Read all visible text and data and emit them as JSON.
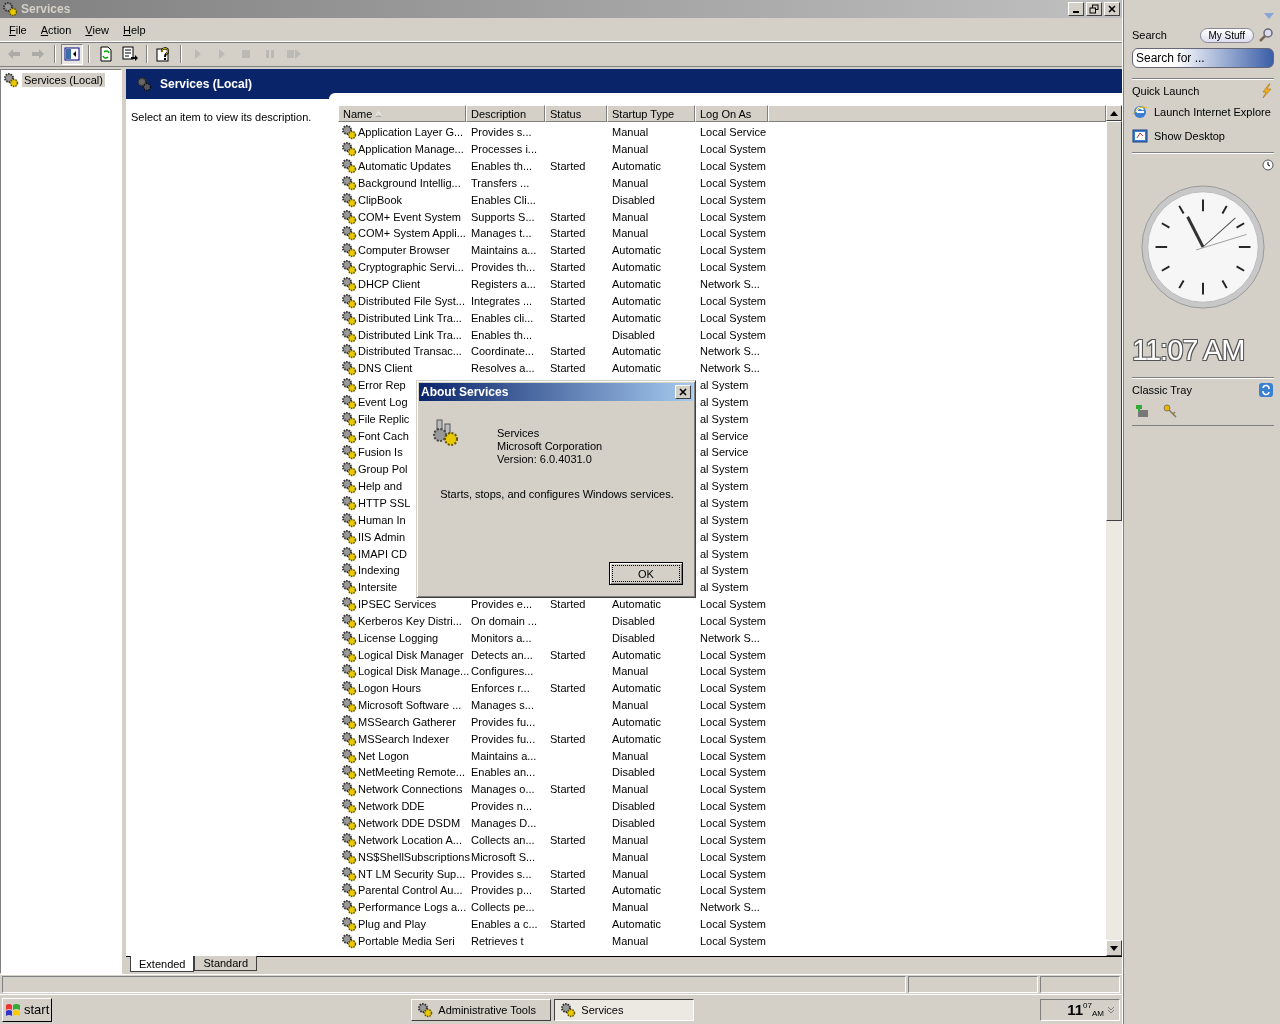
{
  "window": {
    "title": "Services"
  },
  "menu": [
    "File",
    "Action",
    "View",
    "Help"
  ],
  "toolbar": {
    "groups": [
      [
        {
          "kind": "back",
          "disabled": true,
          "pressed": false
        },
        {
          "kind": "forward",
          "disabled": true,
          "pressed": false
        }
      ],
      [
        {
          "kind": "tree",
          "disabled": false,
          "pressed": true
        }
      ],
      [
        {
          "kind": "refresh",
          "disabled": false,
          "pressed": false
        },
        {
          "kind": "export",
          "disabled": false,
          "pressed": false
        }
      ],
      [
        {
          "kind": "help",
          "disabled": false,
          "pressed": false
        }
      ],
      [
        {
          "kind": "start",
          "disabled": true,
          "pressed": false
        },
        {
          "kind": "start",
          "disabled": true,
          "pressed": false
        },
        {
          "kind": "stop",
          "disabled": true,
          "pressed": false
        },
        {
          "kind": "pause",
          "disabled": true,
          "pressed": false
        },
        {
          "kind": "restart",
          "disabled": true,
          "pressed": false
        }
      ]
    ]
  },
  "tree": {
    "items": [
      {
        "label": "Services (Local)",
        "selected": true
      }
    ]
  },
  "panel": {
    "title": "Services (Local)",
    "description": "Select an item to view its description."
  },
  "table": {
    "columns": [
      {
        "label": "Name",
        "sorted": true
      },
      {
        "label": "Description",
        "sorted": false
      },
      {
        "label": "Status",
        "sorted": false
      },
      {
        "label": "Startup Type",
        "sorted": false
      },
      {
        "label": "Log On As",
        "sorted": false
      }
    ],
    "rows": [
      {
        "name": "Application Layer G...",
        "description": "Provides s...",
        "startup_type": "Manual",
        "log_on_as": "Local Service"
      },
      {
        "name": "Application Manage...",
        "description": "Processes i...",
        "startup_type": "Manual",
        "log_on_as": "Local System"
      },
      {
        "name": "Automatic Updates",
        "description": "Enables th...",
        "status": "Started",
        "startup_type": "Automatic",
        "log_on_as": "Local System"
      },
      {
        "name": "Background Intellig...",
        "description": "Transfers ...",
        "startup_type": "Manual",
        "log_on_as": "Local System"
      },
      {
        "name": "ClipBook",
        "description": "Enables Cli...",
        "startup_type": "Disabled",
        "log_on_as": "Local System"
      },
      {
        "name": "COM+ Event System",
        "description": "Supports S...",
        "status": "Started",
        "startup_type": "Manual",
        "log_on_as": "Local System"
      },
      {
        "name": "COM+ System Appli...",
        "description": "Manages t...",
        "status": "Started",
        "startup_type": "Manual",
        "log_on_as": "Local System"
      },
      {
        "name": "Computer Browser",
        "description": "Maintains a...",
        "status": "Started",
        "startup_type": "Automatic",
        "log_on_as": "Local System"
      },
      {
        "name": "Cryptographic Servi...",
        "description": "Provides th...",
        "status": "Started",
        "startup_type": "Automatic",
        "log_on_as": "Local System"
      },
      {
        "name": "DHCP Client",
        "description": "Registers a...",
        "status": "Started",
        "startup_type": "Automatic",
        "log_on_as": "Network S..."
      },
      {
        "name": "Distributed File Syst...",
        "description": "Integrates ...",
        "status": "Started",
        "startup_type": "Automatic",
        "log_on_as": "Local System"
      },
      {
        "name": "Distributed Link Tra...",
        "description": "Enables cli...",
        "status": "Started",
        "startup_type": "Automatic",
        "log_on_as": "Local System"
      },
      {
        "name": "Distributed Link Tra...",
        "description": "Enables th...",
        "startup_type": "Disabled",
        "log_on_as": "Local System"
      },
      {
        "name": "Distributed Transac...",
        "description": "Coordinate...",
        "status": "Started",
        "startup_type": "Automatic",
        "log_on_as": "Network S..."
      },
      {
        "name": "DNS Client",
        "description": "Resolves a...",
        "status": "Started",
        "startup_type": "Automatic",
        "log_on_as": "Network S..."
      },
      {
        "name": "Error Rep",
        "log_on_as": "al System"
      },
      {
        "name": "Event Log",
        "log_on_as": "al System"
      },
      {
        "name": "File Replic",
        "log_on_as": "al System"
      },
      {
        "name": "Font Cach",
        "log_on_as": "al Service"
      },
      {
        "name": "Fusion Is",
        "log_on_as": "al Service"
      },
      {
        "name": "Group Pol",
        "log_on_as": "al System"
      },
      {
        "name": "Help and",
        "log_on_as": "al System"
      },
      {
        "name": "HTTP SSL",
        "log_on_as": "al System"
      },
      {
        "name": "Human In",
        "log_on_as": "al System"
      },
      {
        "name": "IIS Admin",
        "log_on_as": "al System"
      },
      {
        "name": "IMAPI CD",
        "log_on_as": "al System"
      },
      {
        "name": "Indexing",
        "log_on_as": "al System"
      },
      {
        "name": "Intersite",
        "log_on_as": "al System"
      },
      {
        "name": "IPSEC Services",
        "description": "Provides e...",
        "status": "Started",
        "startup_type": "Automatic",
        "log_on_as": "Local System"
      },
      {
        "name": "Kerberos Key Distri...",
        "description": "On domain ...",
        "startup_type": "Disabled",
        "log_on_as": "Local System"
      },
      {
        "name": "License Logging",
        "description": "Monitors a...",
        "startup_type": "Disabled",
        "log_on_as": "Network S..."
      },
      {
        "name": "Logical Disk Manager",
        "description": "Detects an...",
        "status": "Started",
        "startup_type": "Automatic",
        "log_on_as": "Local System"
      },
      {
        "name": "Logical Disk Manage...",
        "description": "Configures...",
        "startup_type": "Manual",
        "log_on_as": "Local System"
      },
      {
        "name": "Logon Hours",
        "description": "Enforces r...",
        "status": "Started",
        "startup_type": "Automatic",
        "log_on_as": "Local System"
      },
      {
        "name": "Microsoft Software ...",
        "description": "Manages s...",
        "startup_type": "Manual",
        "log_on_as": "Local System"
      },
      {
        "name": "MSSearch Gatherer",
        "description": "Provides fu...",
        "startup_type": "Automatic",
        "log_on_as": "Local System"
      },
      {
        "name": "MSSearch Indexer",
        "description": "Provides fu...",
        "status": "Started",
        "startup_type": "Automatic",
        "log_on_as": "Local System"
      },
      {
        "name": "Net Logon",
        "description": "Maintains a...",
        "startup_type": "Manual",
        "log_on_as": "Local System"
      },
      {
        "name": "NetMeeting Remote...",
        "description": "Enables an...",
        "startup_type": "Disabled",
        "log_on_as": "Local System"
      },
      {
        "name": "Network Connections",
        "description": "Manages o...",
        "status": "Started",
        "startup_type": "Manual",
        "log_on_as": "Local System"
      },
      {
        "name": "Network DDE",
        "description": "Provides n...",
        "startup_type": "Disabled",
        "log_on_as": "Local System"
      },
      {
        "name": "Network DDE DSDM",
        "description": "Manages D...",
        "startup_type": "Disabled",
        "log_on_as": "Local System"
      },
      {
        "name": "Network Location A...",
        "description": "Collects an...",
        "status": "Started",
        "startup_type": "Manual",
        "log_on_as": "Local System"
      },
      {
        "name": "NS$ShellSubscriptions",
        "description": "Microsoft S...",
        "startup_type": "Manual",
        "log_on_as": "Local System"
      },
      {
        "name": "NT LM Security Sup...",
        "description": "Provides s...",
        "status": "Started",
        "startup_type": "Manual",
        "log_on_as": "Local System"
      },
      {
        "name": "Parental Control Au...",
        "description": "Provides p...",
        "status": "Started",
        "startup_type": "Automatic",
        "log_on_as": "Local System"
      },
      {
        "name": "Performance Logs a...",
        "description": "Collects pe...",
        "startup_type": "Manual",
        "log_on_as": "Network S..."
      },
      {
        "name": "Plug and Play",
        "description": "Enables a c...",
        "status": "Started",
        "startup_type": "Automatic",
        "log_on_as": "Local System"
      },
      {
        "name": "Portable Media Seri",
        "description": "Retrieves t",
        "startup_type": "Manual",
        "log_on_as": "Local System"
      }
    ]
  },
  "tabs": [
    {
      "label": "Extended",
      "selected": true
    },
    {
      "label": "Standard",
      "selected": false
    }
  ],
  "dialog": {
    "title": "About Services",
    "product": "Services",
    "company": "Microsoft Corporation",
    "version": "Version: 6.0.4031.0",
    "description": "Starts, stops, and configures Windows services.",
    "button": "OK"
  },
  "sidebar": {
    "search": {
      "title": "Search",
      "button": "My Stuff",
      "placeholder": "Search for ..."
    },
    "quick_launch": {
      "title": "Quick Launch",
      "items": [
        {
          "label": "Launch Internet Explore",
          "kind": "browser"
        },
        {
          "label": "Show Desktop",
          "kind": "desktop"
        }
      ]
    },
    "clock": {
      "time": "11:07 AM"
    },
    "classic_tray": {
      "title": "Classic Tray"
    }
  },
  "taskbar": {
    "start": "start",
    "tasks": [
      {
        "label": "Administrative Tools",
        "selected": false
      },
      {
        "label": "Services",
        "selected": true
      }
    ],
    "clock": {
      "hour": "11",
      "minute": "07",
      "period": "AM"
    }
  }
}
